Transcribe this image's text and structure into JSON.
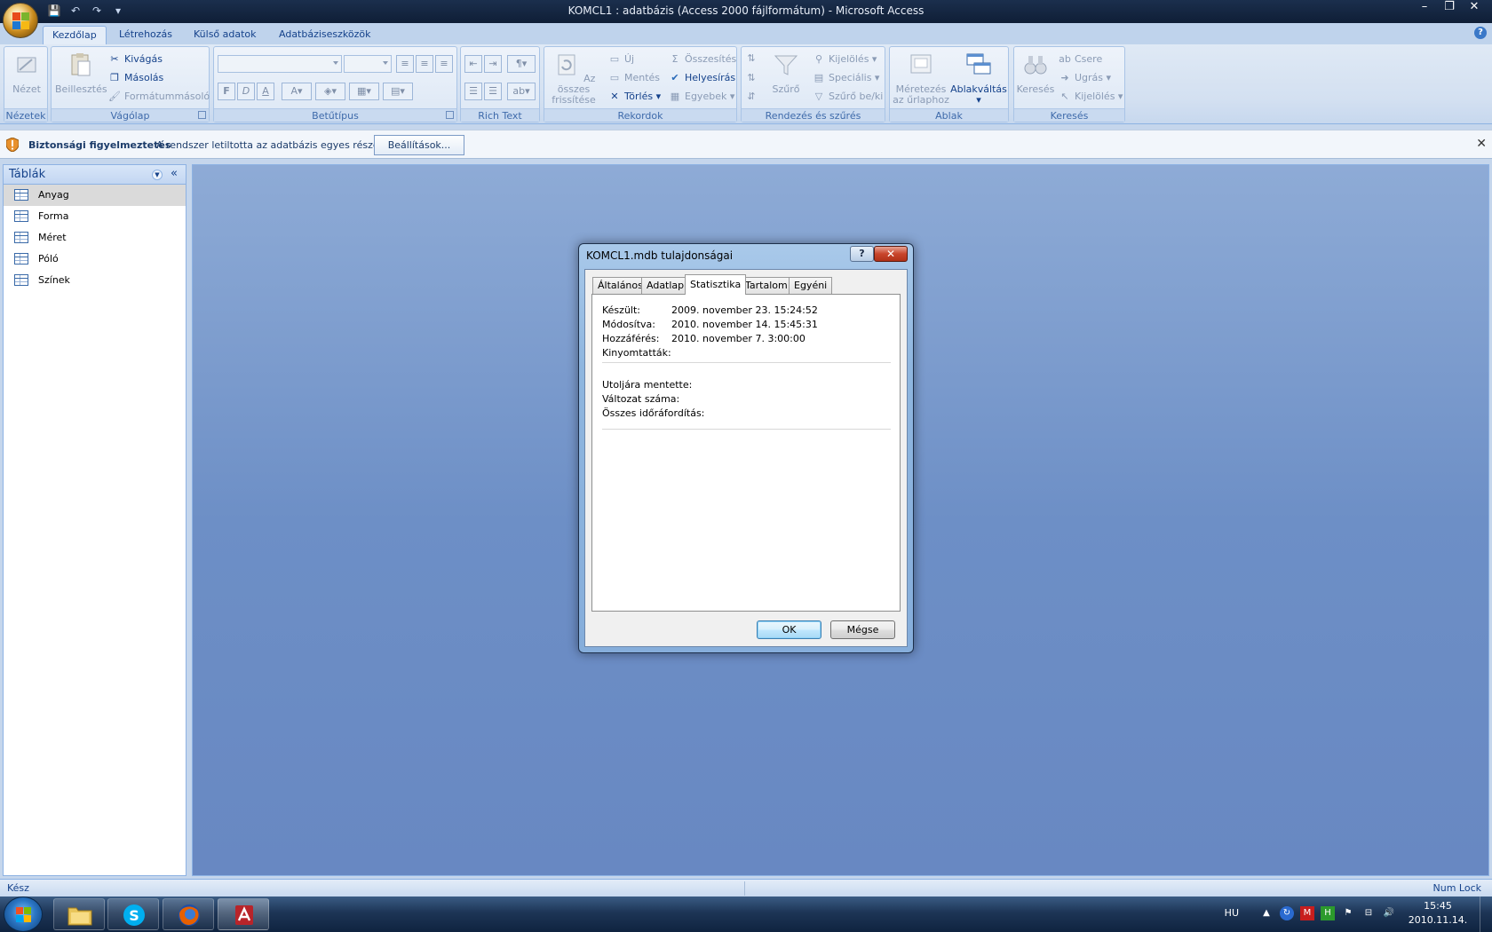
{
  "window": {
    "title": "KOMCL1 : adatbázis (Access 2000 fájlformátum) - Microsoft Access",
    "controls": {
      "minimize": "–",
      "restore": "❐",
      "close": "✕"
    }
  },
  "quick_access": {
    "save": "💾",
    "undo": "↶",
    "redo": "↷",
    "customize": "▾"
  },
  "ribbon": {
    "tabs": [
      "Kezdőlap",
      "Létrehozás",
      "Külső adatok",
      "Adatbázis­eszközök"
    ],
    "active_tab": "Kezdőlap",
    "groups": {
      "nezetek": {
        "label": "Nézetek",
        "view": "Nézet"
      },
      "vagolap": {
        "label": "Vágólap",
        "paste": "Beillesztés",
        "cut": "Kivágás",
        "copy": "Másolás",
        "format_painter": "Formátummásoló"
      },
      "betutipus": {
        "label": "Betűtípus",
        "bold": "F",
        "italic": "D",
        "underline": "A"
      },
      "richtext": {
        "label": "Rich Text"
      },
      "rekordok": {
        "label": "Rekordok",
        "refresh": "Az összes frissítése",
        "new": "Új",
        "save": "Mentés",
        "delete": "Törlés",
        "totals": "Összesítés",
        "spelling": "Helyesírás",
        "more": "Egyebek"
      },
      "rendezes": {
        "label": "Rendezés és szűrés",
        "filter": "Szűrő",
        "selection": "Kijelölés",
        "advanced": "Speciális",
        "toggle": "Szűrő be/ki"
      },
      "ablak": {
        "label": "Ablak",
        "size_to_fit": "Méretezés az űrlaphoz",
        "switch": "Ablakváltás"
      },
      "kereses": {
        "label": "Keresés",
        "find": "Keresés",
        "replace": "Csere",
        "goto": "Ugrás",
        "select": "Kijelölés"
      }
    }
  },
  "message_bar": {
    "title": "Biztonsági figyelmeztetés",
    "text": "A rendszer letiltotta az adatbázis egyes részeit",
    "button": "Beállítások...",
    "close": "✕"
  },
  "nav_pane": {
    "title": "Táblák",
    "items": [
      "Anyag",
      "Forma",
      "Méret",
      "Póló",
      "Színek"
    ],
    "selected": "Anyag"
  },
  "dialog": {
    "title": "KOMCL1.mdb tulajdonságai",
    "help": "?",
    "close": "✕",
    "tabs": [
      "Általános",
      "Adatlap",
      "Statisztika",
      "Tartalom",
      "Egyéni"
    ],
    "active_tab": "Statisztika",
    "stats": [
      {
        "label": "Készült:",
        "value": "2009. november 23. 15:24:52"
      },
      {
        "label": "Módosítva:",
        "value": "2010. november 14. 15:45:31"
      },
      {
        "label": "Hozzáférés:",
        "value": "2010. november 7. 3:00:00"
      },
      {
        "label": "Kinyomtatták:",
        "value": ""
      }
    ],
    "stats2": [
      {
        "label": "Utoljára mentette:",
        "value": ""
      },
      {
        "label": "Változat száma:",
        "value": ""
      },
      {
        "label": "Összes időráfordítás:",
        "value": ""
      }
    ],
    "ok": "OK",
    "cancel": "Mégse"
  },
  "status_bar": {
    "left": "Kész",
    "right": "Num Lock"
  },
  "taskbar": {
    "apps": [
      "Windows Explorer",
      "Skype",
      "Firefox",
      "Microsoft Access"
    ],
    "language": "HU",
    "time": "15:45",
    "date": "2010.11.14."
  }
}
